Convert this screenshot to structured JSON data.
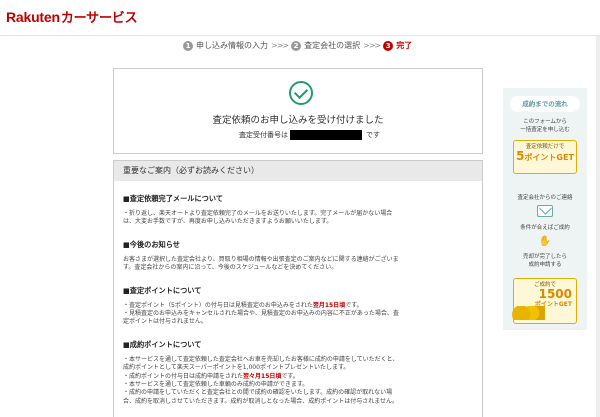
{
  "header": {
    "logo_brand": "Rakuten",
    "logo_service": "カーサービス"
  },
  "steps": [
    {
      "num": "1",
      "label": "申し込み情報の入力"
    },
    {
      "num": "2",
      "label": "査定会社の選択"
    },
    {
      "num": "3",
      "label": "完了"
    }
  ],
  "step_arrow": ">>>",
  "confirmation": {
    "title": "査定依頼のお申し込みを受け付けました",
    "receipt_label": "査定受付番号は",
    "receipt_suffix": "です"
  },
  "notice": {
    "header": "重要なご案内（必ずお読みください）",
    "sections": [
      {
        "title": "■査定依頼完了メールについて",
        "lines": [
          "・折り返し、楽天オートより査定依頼完了のメールをお送りいたします。完了メールが届かない場合",
          "は、大変お手数ですが、再度お申し込みいただきますようお願いいたします。"
        ]
      },
      {
        "title": "■今後のお知らせ",
        "lines": [
          "お客さまが選択した査定会社より、買取り相場の情報や出張査定のご案内などに関する連絡がございま",
          "す。査定会社からの案内に沿って、今後のスケジュールなどを決めてください。"
        ]
      },
      {
        "title": "■査定ポイントについて",
        "lines": [
          "・査定ポイント（5ポイント）の付与日は見積査定のお申込みをされた",
          "・見積査定のお申込みをキャンセルされた場合や、見積査定のお申込みの内容に不正があった場合、査",
          "定ポイントは付与されません。"
        ],
        "red": "翌月15日頃",
        "after_red": "です。"
      },
      {
        "title": "■成約ポイントについて",
        "lines": [
          "・本サービスを通して査定依頼した査定会社へお車を売却したお客様に成約の申請をしていただくと、",
          "成約ポイントとして楽天スーパーポイントを1,000ポイントプレゼントいたします。",
          "・成約ポイントの付与日は成約申請をされた",
          "・本サービスを通して査定依頼した車輌のみ成約の申請ができます。",
          "・成約の申請をしていただくと査定会社との間で成約の確認をいたします。成約の確認が取れない場",
          "合、成約を取消しさせていただきます。成約が取消しとなった場合、成約ポイントは付与されません。"
        ],
        "red": "翌々月15日頃",
        "after_red": "です。"
      }
    ]
  },
  "side": {
    "heading": "成約までの流れ",
    "intro": [
      "このフォームから",
      "一括査定を申し込む"
    ],
    "card1_small": "査定依頼だけで",
    "card1_big_num": "5",
    "card1_big_text": "ポイントGET",
    "contact": "査定会社からのご連絡",
    "agree": "条件が合えばご成約",
    "after_sale": [
      "売却が完了したら",
      "成約申請する"
    ],
    "card2_small": "ご成約で",
    "card2_big_num": "1500",
    "card2_big_text": "ポイントGET"
  }
}
